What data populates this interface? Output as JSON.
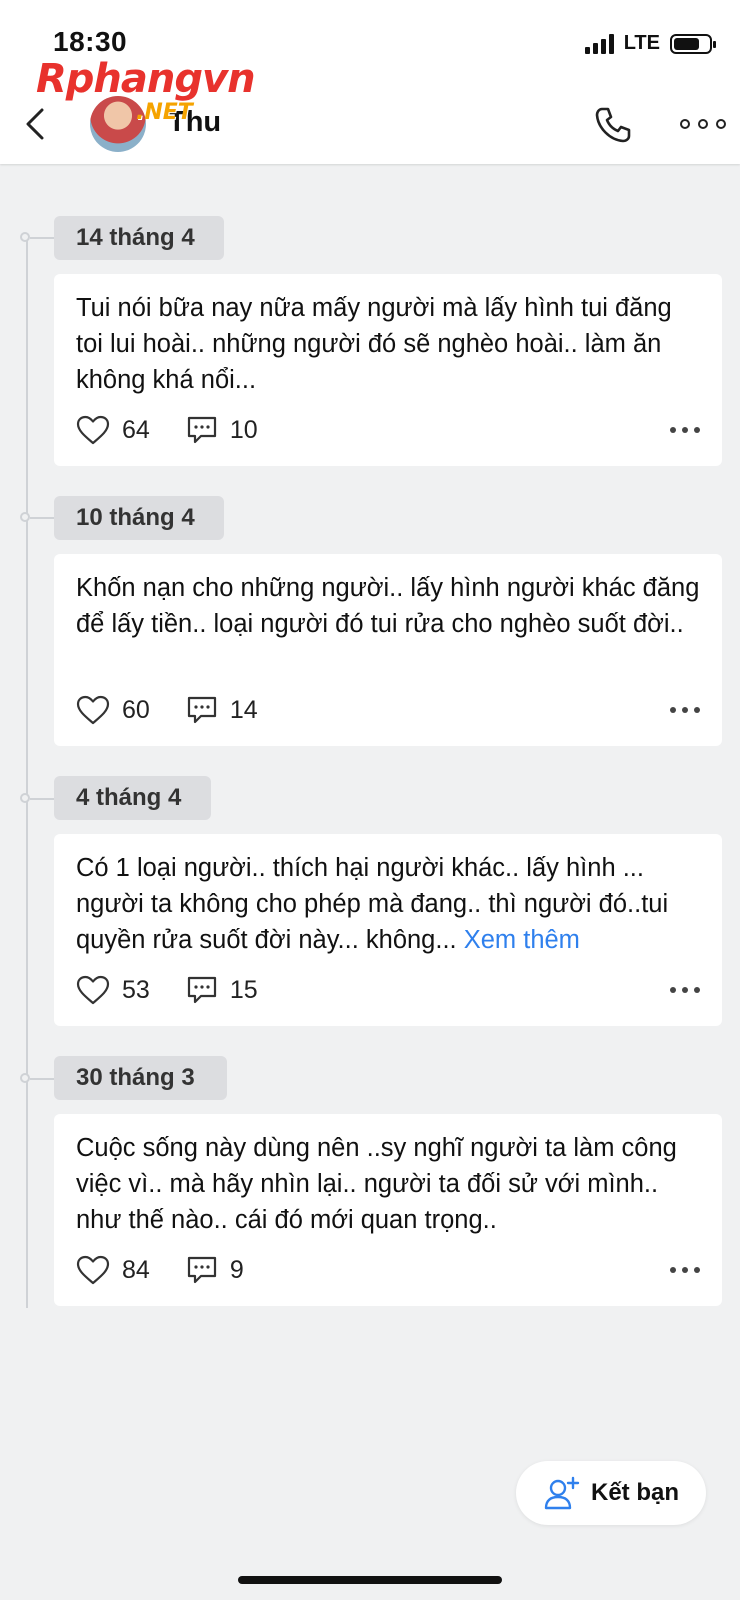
{
  "status_bar": {
    "time": "18:30",
    "network": "LTE"
  },
  "watermark": {
    "main": "Rphangvn",
    "sub": ".NET"
  },
  "header": {
    "name": "Thu",
    "icons": [
      "back-icon",
      "avatar",
      "phone-icon",
      "more-icon"
    ]
  },
  "posts": [
    {
      "date": "14 tháng 4",
      "text": "Tui nói bữa nay nữa mấy người mà lấy hình tui đăng toi lui hoài.. những người đó sẽ nghèo hoài.. làm ăn không khá nổi...",
      "see_more": "",
      "likes": "64",
      "comments": "10"
    },
    {
      "date": "10 tháng 4",
      "text": "Khốn nạn cho những người.. lấy hình người khác đăng để lấy tiền.. loại người đó tui rửa cho nghèo suốt đời..",
      "see_more": "",
      "likes": "60",
      "comments": "14"
    },
    {
      "date": "4 tháng 4",
      "text": "Có 1 loại người.. thích hại người khác.. lấy hình ... người ta không cho phép mà đang.. thì người đó..tui quyền rửa suốt đời này... không... ",
      "see_more": "Xem thêm",
      "likes": "53",
      "comments": "15"
    },
    {
      "date": "30 tháng 3",
      "text": "Cuộc sống này dùng nên ..sy nghĩ người ta làm công việc vì.. mà hãy nhìn lại.. người ta đối sử với mình.. như thế nào.. cái đó mới quan trọng..",
      "see_more": "",
      "likes": "84",
      "comments": "9"
    }
  ],
  "add_friend": {
    "label": "Kết bạn"
  },
  "colors": {
    "link": "#2f80ed",
    "background": "#f0f1f2",
    "chip": "#dcdde0"
  }
}
